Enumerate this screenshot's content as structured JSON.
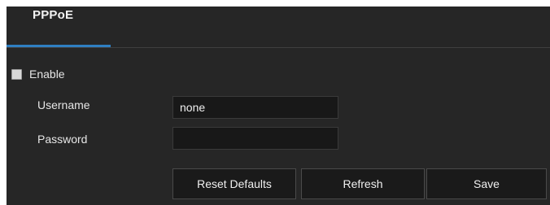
{
  "tab": {
    "label": "PPPoE"
  },
  "form": {
    "enable_label": "Enable",
    "enable_checked": false,
    "username_label": "Username",
    "username_value": "none",
    "password_label": "Password",
    "password_value": ""
  },
  "buttons": {
    "reset_label": "Reset Defaults",
    "refresh_label": "Refresh",
    "save_label": "Save"
  },
  "colors": {
    "panel_background": "#262626",
    "accent": "#2f7fc2",
    "field_background": "#181818"
  }
}
